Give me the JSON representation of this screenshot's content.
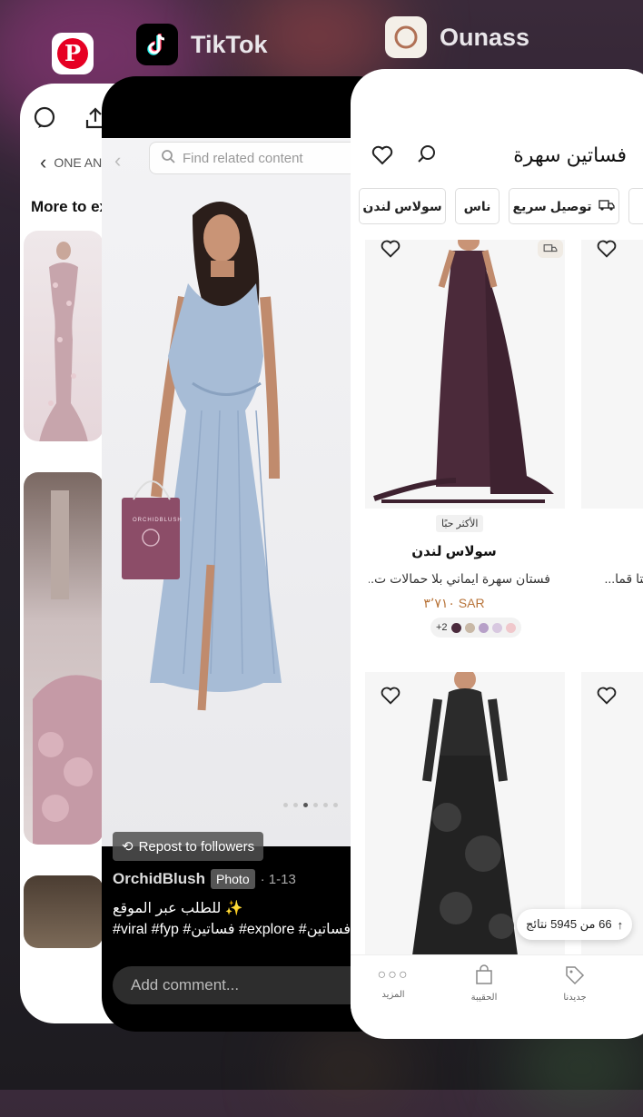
{
  "apps": {
    "pinterest": {
      "label": ""
    },
    "tiktok": {
      "label": "TikTok"
    },
    "ounass": {
      "label": "Ounass"
    }
  },
  "pinterest": {
    "brand_row": "ONE ANG",
    "more_label": "More to ex"
  },
  "tiktok": {
    "search_placeholder": "Find related content",
    "repost_label": "Repost to followers",
    "author": "OrchidBlush",
    "photo_badge": "Photo",
    "date": "· 1-13",
    "caption_line1": "للطلب عبر الموقع ✨",
    "caption_line2": "#viral #fyp #فساتين #explore #فساتين",
    "comment_placeholder": "Add comment...",
    "bag_brand": "ORCHIDBLUSH"
  },
  "ounass": {
    "title": "فساتين سهرة",
    "chips": {
      "delivery": "توصيل سريع",
      "nas": "ناس",
      "solace": "سولاس لندن"
    },
    "product1": {
      "badge": "الأكثر حبًا",
      "brand": "سولاس لندن",
      "name": "فستان سهرة ايماني بلا حمالات ت...",
      "price": "٣٬٧١٠ SAR",
      "more_colors": "+2",
      "swatch_colors": [
        "#4a2a3c",
        "#c8b8a6",
        "#b7a0c8",
        "#d8c8e0",
        "#f0c8cc"
      ]
    },
    "product2": {
      "name_partial": "وريتا قما..."
    },
    "results_label": "66 من 5945 نتائج",
    "tabs": {
      "new": "جديدنا",
      "bag": "الحقيبة",
      "more": "المزيد"
    }
  }
}
